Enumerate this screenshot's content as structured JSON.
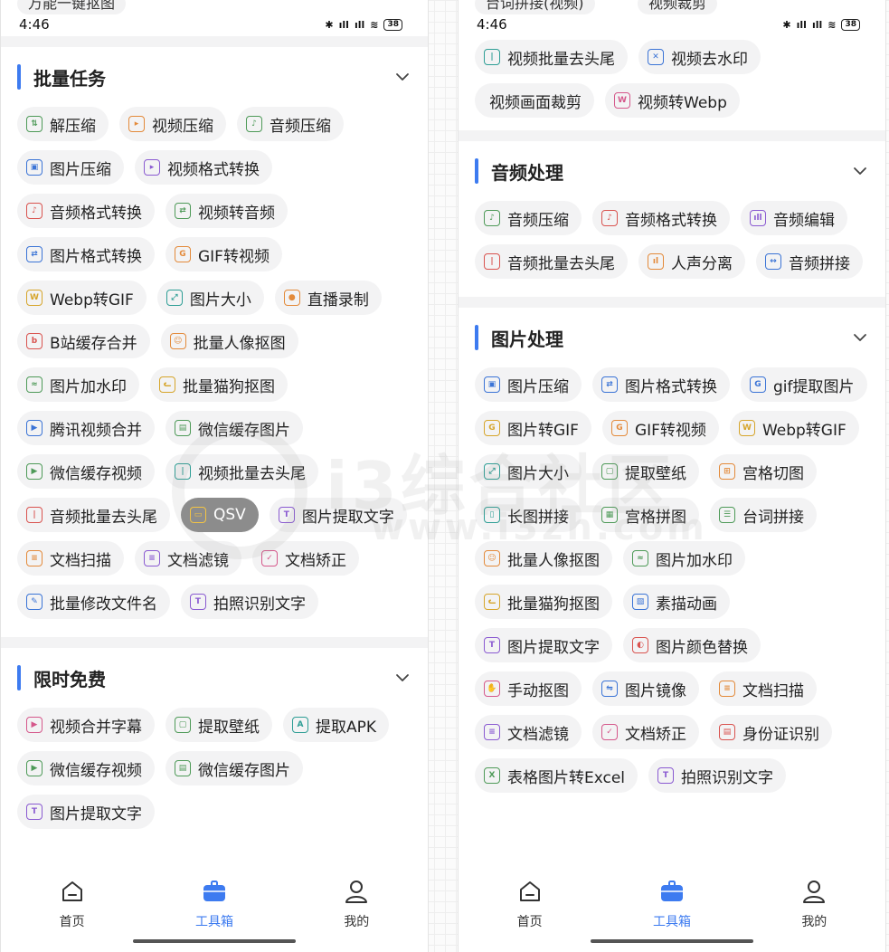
{
  "status_time": "4:46",
  "battery": "38",
  "left": {
    "top_clip": "万能一键抠图",
    "sections": [
      {
        "title": "批量任务",
        "items": [
          {
            "label": "解压缩",
            "icon": "unzip-icon",
            "color": "green"
          },
          {
            "label": "视频压缩",
            "icon": "video-compress-icon",
            "color": "orange"
          },
          {
            "label": "音频压缩",
            "icon": "audio-compress-icon",
            "color": "green"
          },
          {
            "label": "图片压缩",
            "icon": "image-compress-icon",
            "color": "blue"
          },
          {
            "label": "视频格式转换",
            "icon": "video-convert-icon",
            "color": "purple"
          },
          {
            "label": "音频格式转换",
            "icon": "audio-convert-icon",
            "color": "red"
          },
          {
            "label": "视频转音频",
            "icon": "video-to-audio-icon",
            "color": "green"
          },
          {
            "label": "图片格式转换",
            "icon": "image-convert-icon",
            "color": "blue"
          },
          {
            "label": "GIF转视频",
            "icon": "gif-to-video-icon",
            "color": "orange"
          },
          {
            "label": "Webp转GIF",
            "icon": "webp-to-gif-icon",
            "color": "gold"
          },
          {
            "label": "图片大小",
            "icon": "image-size-icon",
            "color": "teal"
          },
          {
            "label": "直播录制",
            "icon": "live-record-icon",
            "color": "orange"
          },
          {
            "label": "B站缓存合并",
            "icon": "bilibili-icon",
            "color": "red"
          },
          {
            "label": "批量人像抠图",
            "icon": "portrait-cutout-icon",
            "color": "orange"
          },
          {
            "label": "图片加水印",
            "icon": "watermark-icon",
            "color": "green"
          },
          {
            "label": "批量猫狗抠图",
            "icon": "pet-cutout-icon",
            "color": "gold"
          },
          {
            "label": "腾讯视频合并",
            "icon": "tencent-video-icon",
            "color": "blue"
          },
          {
            "label": "微信缓存图片",
            "icon": "wechat-image-icon",
            "color": "green"
          },
          {
            "label": "微信缓存视频",
            "icon": "wechat-video-icon",
            "color": "green"
          },
          {
            "label": "视频批量去头尾",
            "icon": "video-trim-icon",
            "color": "teal"
          },
          {
            "label": "音频批量去头尾",
            "icon": "audio-trim-icon",
            "color": "red"
          },
          {
            "label": "QSV",
            "icon": "qsv-icon",
            "color": "gold",
            "dark": true
          },
          {
            "label": "图片提取文字",
            "icon": "ocr-icon",
            "color": "purple"
          },
          {
            "label": "文档扫描",
            "icon": "doc-scan-icon",
            "color": "orange"
          },
          {
            "label": "文档滤镜",
            "icon": "doc-filter-icon",
            "color": "purple"
          },
          {
            "label": "文档矫正",
            "icon": "doc-correct-icon",
            "color": "pink"
          },
          {
            "label": "批量修改文件名",
            "icon": "rename-icon",
            "color": "blue"
          },
          {
            "label": "拍照识别文字",
            "icon": "photo-ocr-icon",
            "color": "purple"
          }
        ]
      },
      {
        "title": "限时免费",
        "items": [
          {
            "label": "视频合并字幕",
            "icon": "subtitle-merge-icon",
            "color": "pink"
          },
          {
            "label": "提取壁纸",
            "icon": "wallpaper-icon",
            "color": "green"
          },
          {
            "label": "提取APK",
            "icon": "apk-icon",
            "color": "teal"
          },
          {
            "label": "微信缓存视频",
            "icon": "wechat-video-icon",
            "color": "green"
          },
          {
            "label": "微信缓存图片",
            "icon": "wechat-image-icon",
            "color": "green"
          },
          {
            "label": "图片提取文字",
            "icon": "ocr-icon",
            "color": "purple"
          }
        ]
      }
    ]
  },
  "right": {
    "top_clip_1": "台词拼接(视频)",
    "top_clip_2": "视频裁剪",
    "partial_items": [
      {
        "label": "视频批量去头尾",
        "icon": "video-trim-icon",
        "color": "teal"
      },
      {
        "label": "视频去水印",
        "icon": "remove-watermark-icon",
        "color": "blue"
      },
      {
        "label": "视频画面裁剪",
        "icon": "",
        "color": ""
      },
      {
        "label": "视频转Webp",
        "icon": "video-to-webp-icon",
        "color": "pink"
      }
    ],
    "sections": [
      {
        "title": "音频处理",
        "items": [
          {
            "label": "音频压缩",
            "icon": "audio-compress-icon",
            "color": "green"
          },
          {
            "label": "音频格式转换",
            "icon": "audio-convert-icon",
            "color": "red"
          },
          {
            "label": "音频编辑",
            "icon": "audio-edit-icon",
            "color": "purple"
          },
          {
            "label": "音频批量去头尾",
            "icon": "audio-trim-icon",
            "color": "red"
          },
          {
            "label": "人声分离",
            "icon": "vocal-separate-icon",
            "color": "orange"
          },
          {
            "label": "音频拼接",
            "icon": "audio-join-icon",
            "color": "blue"
          }
        ]
      },
      {
        "title": "图片处理",
        "items": [
          {
            "label": "图片压缩",
            "icon": "image-compress-icon",
            "color": "blue"
          },
          {
            "label": "图片格式转换",
            "icon": "image-convert-icon",
            "color": "blue"
          },
          {
            "label": "gif提取图片",
            "icon": "gif-extract-icon",
            "color": "blue"
          },
          {
            "label": "图片转GIF",
            "icon": "image-to-gif-icon",
            "color": "gold"
          },
          {
            "label": "GIF转视频",
            "icon": "gif-to-video-icon",
            "color": "orange"
          },
          {
            "label": "Webp转GIF",
            "icon": "webp-to-gif-icon",
            "color": "gold"
          },
          {
            "label": "图片大小",
            "icon": "image-size-icon",
            "color": "teal"
          },
          {
            "label": "提取壁纸",
            "icon": "wallpaper-icon",
            "color": "green"
          },
          {
            "label": "宫格切图",
            "icon": "grid-cut-icon",
            "color": "orange"
          },
          {
            "label": "长图拼接",
            "icon": "long-image-icon",
            "color": "teal"
          },
          {
            "label": "宫格拼图",
            "icon": "grid-collage-icon",
            "color": "green"
          },
          {
            "label": "台词拼接",
            "icon": "caption-join-icon",
            "color": "green"
          },
          {
            "label": "批量人像抠图",
            "icon": "portrait-cutout-icon",
            "color": "orange"
          },
          {
            "label": "图片加水印",
            "icon": "watermark-icon",
            "color": "green"
          },
          {
            "label": "批量猫狗抠图",
            "icon": "pet-cutout-icon",
            "color": "gold"
          },
          {
            "label": "素描动画",
            "icon": "sketch-icon",
            "color": "blue"
          },
          {
            "label": "图片提取文字",
            "icon": "ocr-icon",
            "color": "purple"
          },
          {
            "label": "图片颜色替换",
            "icon": "color-replace-icon",
            "color": "red"
          },
          {
            "label": "手动抠图",
            "icon": "manual-cutout-icon",
            "color": "pink"
          },
          {
            "label": "图片镜像",
            "icon": "mirror-icon",
            "color": "blue"
          },
          {
            "label": "文档扫描",
            "icon": "doc-scan-icon",
            "color": "orange"
          },
          {
            "label": "文档滤镜",
            "icon": "doc-filter-icon",
            "color": "purple"
          },
          {
            "label": "文档矫正",
            "icon": "doc-correct-icon",
            "color": "pink"
          },
          {
            "label": "身份证识别",
            "icon": "id-card-icon",
            "color": "red"
          },
          {
            "label": "表格图片转Excel",
            "icon": "excel-icon",
            "color": "green"
          },
          {
            "label": "拍照识别文字",
            "icon": "photo-ocr-icon",
            "color": "purple"
          }
        ]
      }
    ]
  },
  "tabs": [
    {
      "label": "首页",
      "icon": "home-icon"
    },
    {
      "label": "工具箱",
      "icon": "toolbox-icon",
      "active": true
    },
    {
      "label": "我的",
      "icon": "profile-icon"
    }
  ],
  "watermark": {
    "text": "i3综合社区",
    "url": "www.i3zh.com"
  },
  "colors": {
    "accent": "#3d7bf0",
    "chip_bg": "#f3f3f4",
    "green": "#4e9a58",
    "orange": "#e38a3a",
    "blue": "#3b74d6",
    "purple": "#8a5ad1",
    "red": "#d9534f",
    "pink": "#d5588b",
    "teal": "#2e9e95",
    "gold": "#d6a52b"
  }
}
